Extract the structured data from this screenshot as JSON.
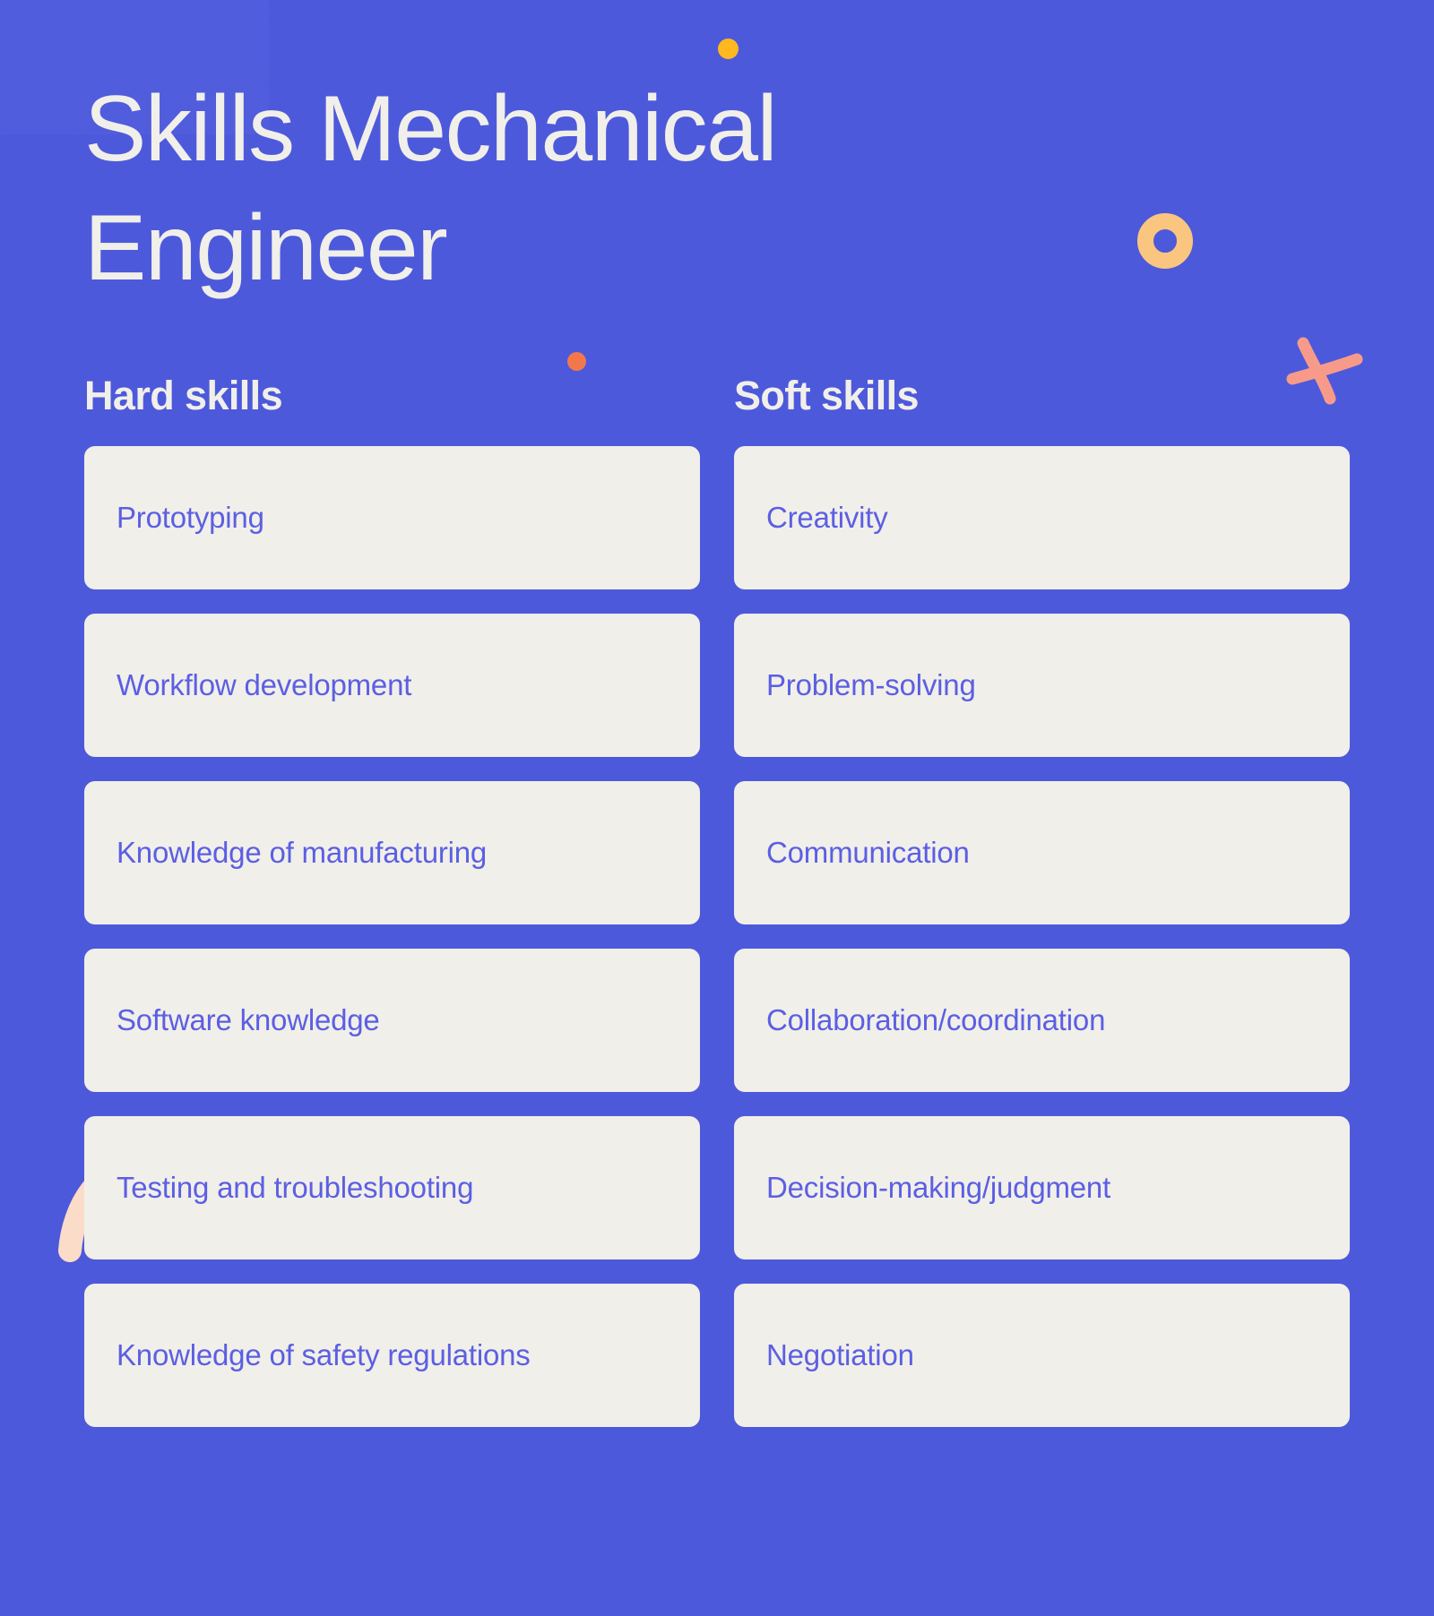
{
  "page": {
    "title": "Skills Mechanical Engineer",
    "background_color": "#4D59DB",
    "card_color": "#F1EFE9",
    "card_text_color": "#5B5FE3",
    "heading_text_color": "#F1EFE9"
  },
  "decorations": [
    {
      "name": "dot-yellow",
      "shape": "filled-circle",
      "color": "#FFB81F"
    },
    {
      "name": "dot-orange",
      "shape": "filled-circle",
      "color": "#F2784B"
    },
    {
      "name": "ring-amber",
      "shape": "donut-ring",
      "color": "#FAC57E"
    },
    {
      "name": "cross-coral",
      "shape": "hand-drawn-x",
      "color": "#F89A8A"
    },
    {
      "name": "arc-amber",
      "shape": "filled-circle",
      "color": "#FAC57E"
    },
    {
      "name": "squiggle-peach",
      "shape": "hand-drawn-curve",
      "color": "#FBDCC8"
    }
  ],
  "columns": [
    {
      "heading": "Hard skills",
      "skills": [
        "Prototyping",
        "Workflow development",
        "Knowledge of manufacturing",
        "Software knowledge",
        "Testing and troubleshooting",
        "Knowledge of safety regulations"
      ]
    },
    {
      "heading": "Soft skills",
      "skills": [
        "Creativity",
        "Problem-solving",
        "Communication",
        "Collaboration/coordination",
        "Decision-making/judgment",
        "Negotiation"
      ]
    }
  ]
}
